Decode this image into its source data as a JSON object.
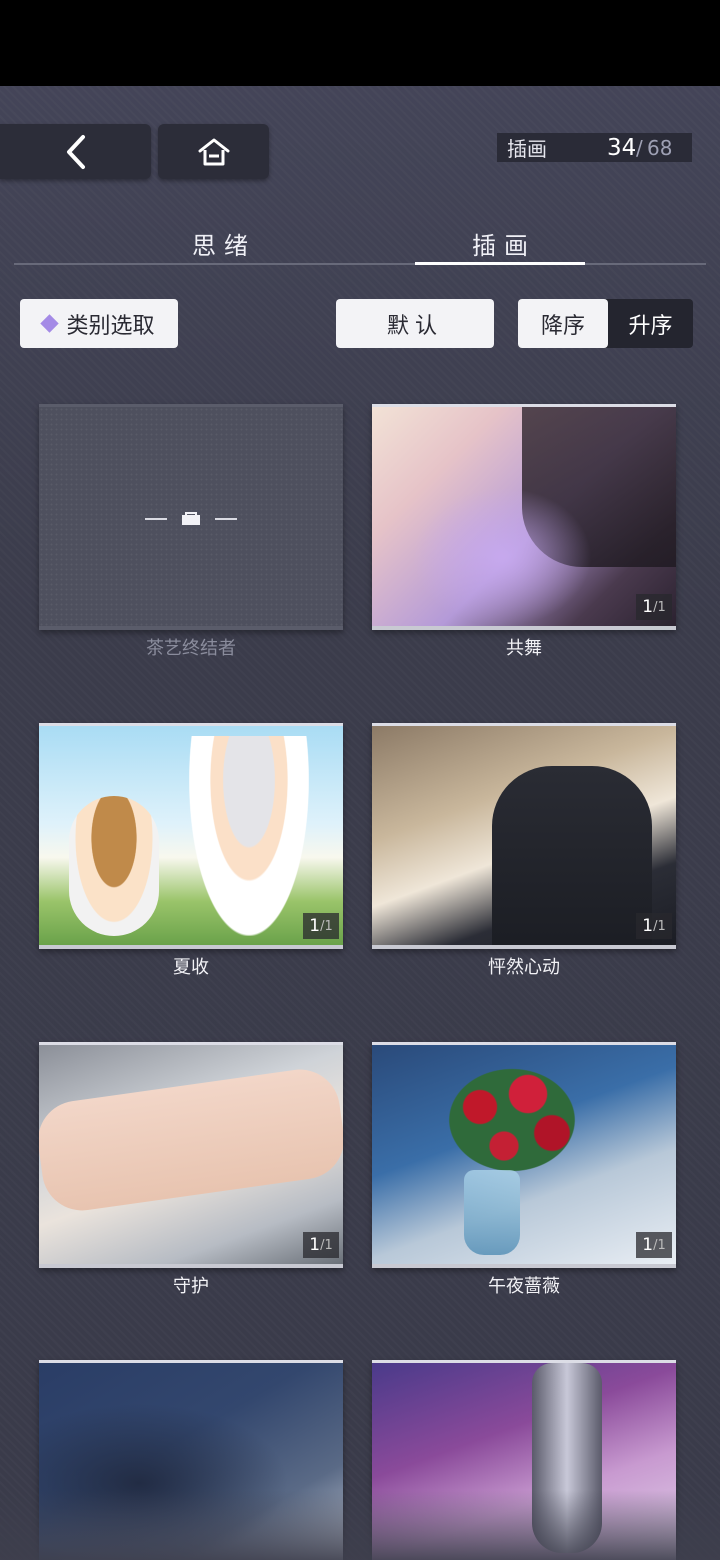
{
  "nav": {
    "back_icon": "chevron-left-icon",
    "home_icon": "home-icon"
  },
  "counter": {
    "label": "插画",
    "current": "34",
    "separator": "/",
    "total": "68"
  },
  "tabs": [
    {
      "label": "思绪",
      "active": false
    },
    {
      "label": "插画",
      "active": true
    }
  ],
  "filters": {
    "category_label": "类别选取",
    "default_label": "默认",
    "sort_desc_label": "降序",
    "sort_asc_label": "升序",
    "sort_selected": "降序"
  },
  "cards": [
    {
      "title": "茶艺终结者",
      "locked": true,
      "badge": ""
    },
    {
      "title": "共舞",
      "locked": false,
      "badge": "1",
      "badge_total": "/1"
    },
    {
      "title": "夏收",
      "locked": false,
      "badge": "1",
      "badge_total": "/1"
    },
    {
      "title": "怦然心动",
      "locked": false,
      "badge": "1",
      "badge_total": "/1"
    },
    {
      "title": "守护",
      "locked": false,
      "badge": "1",
      "badge_total": "/1"
    },
    {
      "title": "午夜蔷薇",
      "locked": false,
      "badge": "1",
      "badge_total": "/1"
    },
    {
      "title": "",
      "locked": false,
      "badge": ""
    },
    {
      "title": "",
      "locked": false,
      "badge": ""
    }
  ],
  "colors": {
    "background": "#3e3f4d",
    "accent": "#a48ae6",
    "button_bg": "#f3f3f6",
    "dark_button": "#2c2d39"
  }
}
